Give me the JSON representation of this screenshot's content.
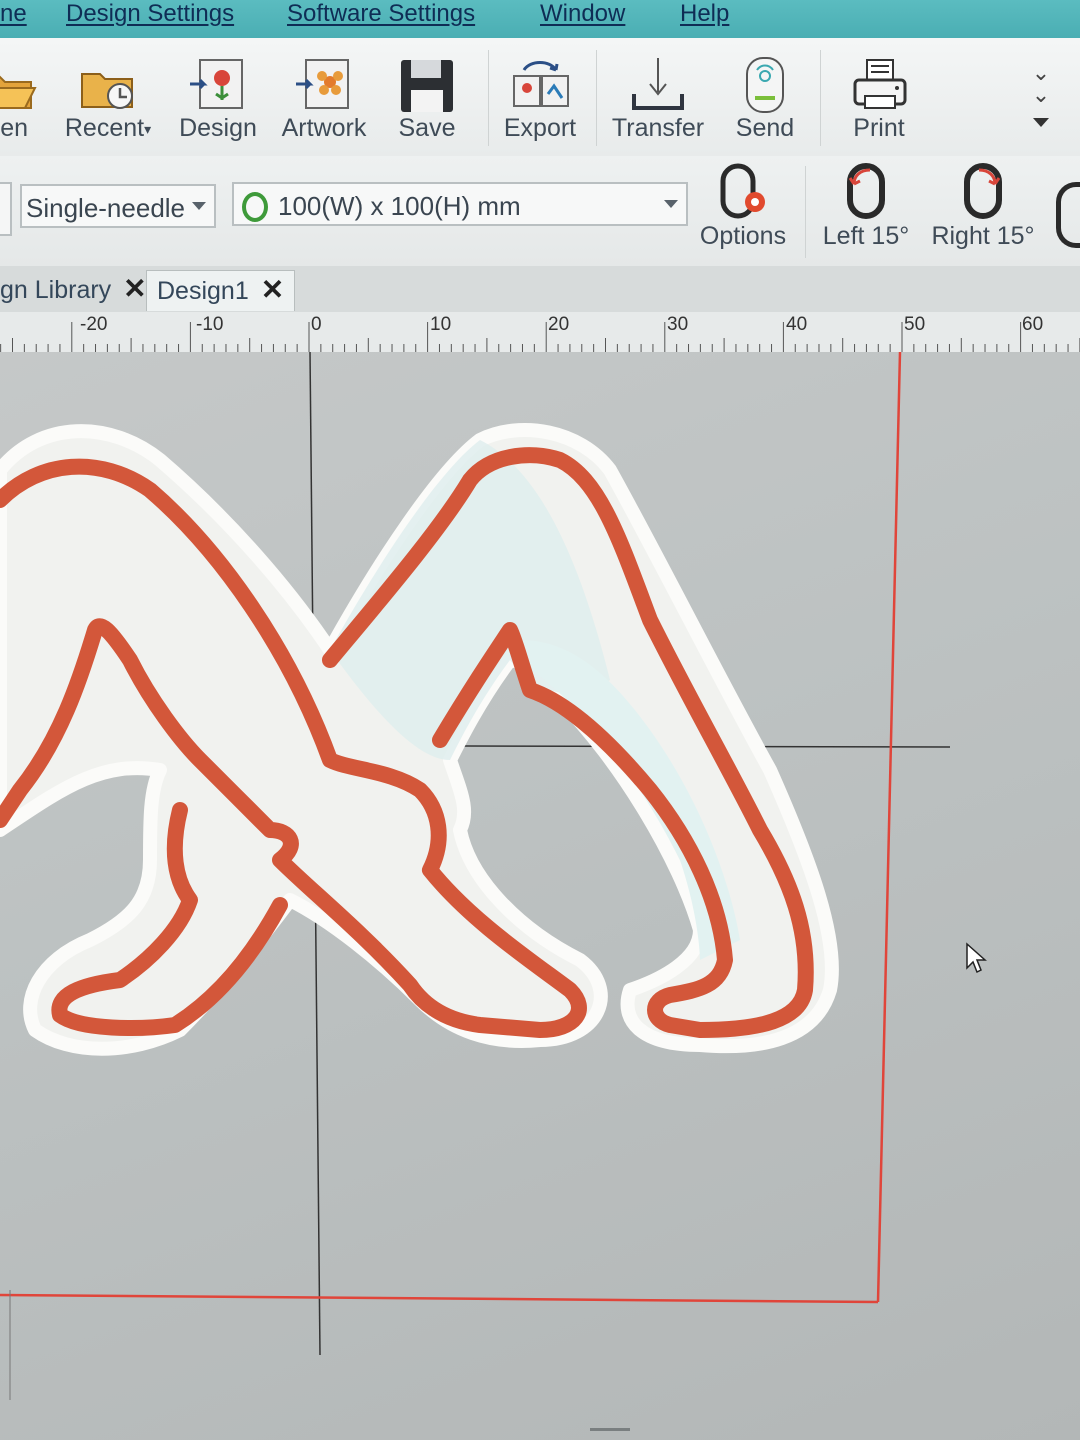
{
  "menu": [
    "ne",
    "Design Settings",
    "Software Settings",
    "Window",
    "Help"
  ],
  "ribbon": {
    "buttons": [
      {
        "label": "en",
        "icon": "open-folder-icon"
      },
      {
        "label": "Recent",
        "icon": "recent-folder-icon"
      },
      {
        "label": "Design",
        "icon": "design-import-icon"
      },
      {
        "label": "Artwork",
        "icon": "artwork-import-icon"
      },
      {
        "label": "Save",
        "icon": "floppy-disk-icon"
      },
      {
        "label": "Export",
        "icon": "export-icon"
      },
      {
        "label": "Transfer",
        "icon": "transfer-icon"
      },
      {
        "label": "Send",
        "icon": "send-usb-icon"
      },
      {
        "label": "Print",
        "icon": "printer-icon"
      }
    ]
  },
  "toolbar": {
    "machine": "Single-needle",
    "hoop": "100(W) x 100(H) mm",
    "options_label": "Options",
    "rotate_left_label": "Left 15°",
    "rotate_right_label": "Right 15°"
  },
  "tabs": [
    {
      "label": "gn Library",
      "close": "✕"
    },
    {
      "label": "Design1",
      "close": "✕"
    }
  ],
  "ruler": {
    "labels": [
      "-20",
      "-10",
      "0",
      "10",
      "20",
      "30",
      "40",
      "50",
      "60"
    ]
  },
  "colors": {
    "menu_bg": "#4aaeb3",
    "hoop_line": "#e0453a",
    "outline_stitch": "#d0573a",
    "satin_border": "#f4f4f2"
  }
}
